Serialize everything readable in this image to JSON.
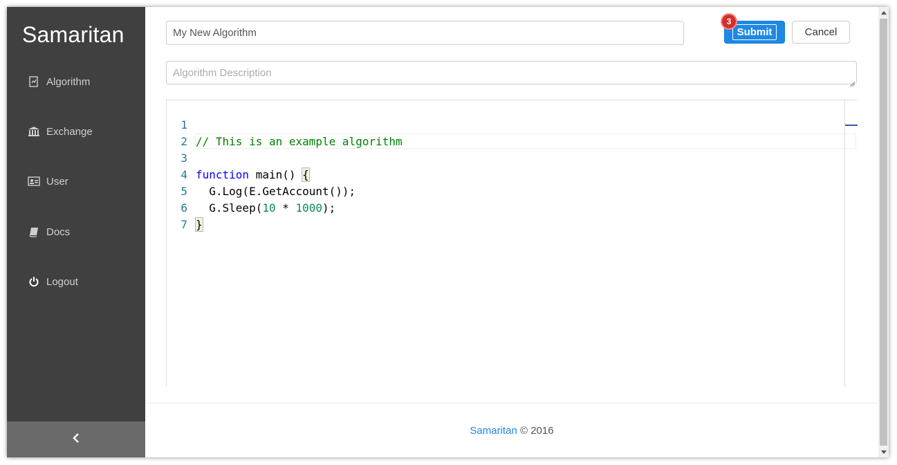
{
  "app": {
    "brand": "Samaritan"
  },
  "sidebar": {
    "items": [
      {
        "label": "Algorithm",
        "icon": "algorithm-icon"
      },
      {
        "label": "Exchange",
        "icon": "bank-icon"
      },
      {
        "label": "User",
        "icon": "id-card-icon"
      },
      {
        "label": "Docs",
        "icon": "book-icon"
      },
      {
        "label": "Logout",
        "icon": "power-icon"
      }
    ],
    "collapse_icon": "chevron-left-icon"
  },
  "form": {
    "name_value": "My New Algorithm",
    "description_placeholder": "Algorithm Description",
    "submit_label": "Submit",
    "cancel_label": "Cancel",
    "badge_count": "3"
  },
  "editor": {
    "line_numbers": [
      "1",
      "2",
      "3",
      "4",
      "5",
      "6",
      "7"
    ],
    "lines": [
      "// This is an example algorithm",
      "",
      "function main() {",
      "  G.Log(E.GetAccount());",
      "  G.Sleep(10 * 1000);",
      "}",
      ""
    ]
  },
  "footer": {
    "brand_link": "Samaritan",
    "copyright": "© 2016"
  },
  "colors": {
    "sidebar_bg": "#404040",
    "accent": "#1e88e5",
    "badge": "#d32f2f"
  }
}
